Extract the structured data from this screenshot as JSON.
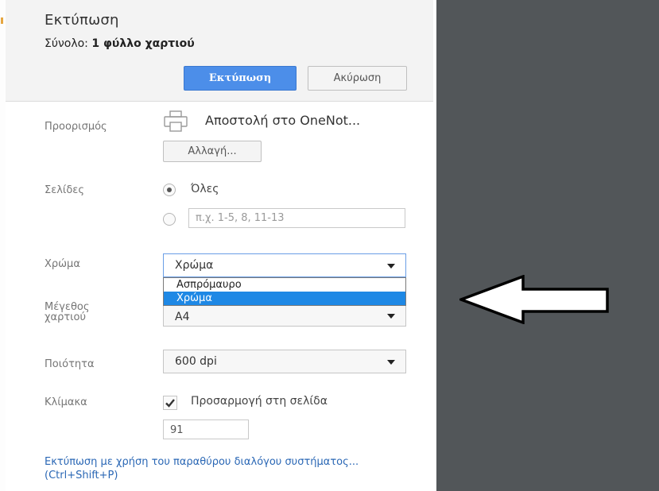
{
  "header": {
    "title": "Εκτύπωση",
    "summary_prefix": "Σύνολο:",
    "summary_value": "1 φύλλο χαρτιού",
    "print_button": "Εκτύπωση",
    "cancel_button": "Ακύρωση"
  },
  "destination": {
    "label": "Προορισμός",
    "printer_name": "Αποστολή στο OneNot...",
    "change_button": "Αλλαγή..."
  },
  "pages": {
    "label": "Σελίδες",
    "all_label": "Όλες",
    "custom_placeholder": "π.χ. 1-5, 8, 11-13",
    "selected": "all"
  },
  "color": {
    "label": "Χρώμα",
    "value": "Χρώμα",
    "options": [
      "Ασπρόμαυρο",
      "Χρώμα"
    ],
    "highlighted_option": "Χρώμα",
    "dropdown_open": true
  },
  "paper_size": {
    "label": "Μέγεθος χαρτιού",
    "value": "A4"
  },
  "quality": {
    "label": "Ποιότητα",
    "value": "600 dpi"
  },
  "scale": {
    "label": "Κλίμακα",
    "fit_label": "Προσαρμογή στη σελίδα",
    "fit_checked": true,
    "value": "91"
  },
  "system_dialog_link": "Εκτύπωση με χρήση του παραθύρου διαλόγου συστήματος... (Ctrl+Shift+P)",
  "colors": {
    "primary_button": "#4c8ee9",
    "selected_option": "#1e88e5",
    "preview_background": "#525659",
    "link": "#2a67b5"
  },
  "icons": [
    "printer-icon",
    "radio-checked-icon",
    "radio-unchecked-icon",
    "chevron-down-icon",
    "checkmark-icon",
    "left-arrow-icon"
  ]
}
